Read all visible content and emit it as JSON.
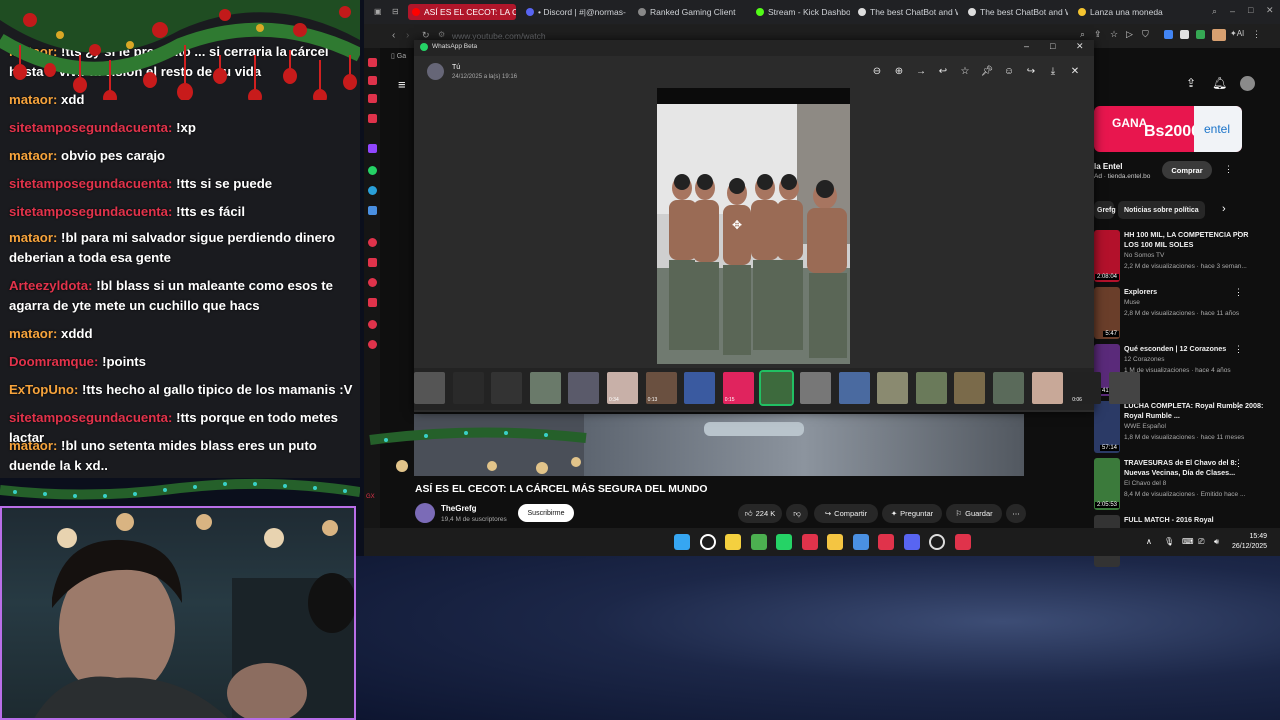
{
  "chat": {
    "messages": [
      {
        "user": "mataor:",
        "text": "!tts ¿y si le pregunto ... si cerraria la cárcel hasta o vivir la vision el resto de su vida",
        "color": "orange"
      },
      {
        "user": "mataor:",
        "text": "xdd",
        "color": "orange"
      },
      {
        "user": "sitetamposegundacuenta:",
        "text": "!xp",
        "color": "red"
      },
      {
        "user": "mataor:",
        "text": "obvio pes carajo",
        "color": "orange"
      },
      {
        "user": "sitetamposegundacuenta:",
        "text": "!tts si se puede",
        "color": "red"
      },
      {
        "user": "sitetamposegundacuenta:",
        "text": "!tts es fácil",
        "color": "red"
      },
      {
        "user": "mataor:",
        "text": "!bl para mi salvador sigue perdiendo dinero deberian a toda esa gente",
        "color": "orange"
      },
      {
        "user": "Arteezyldota:",
        "text": "!bl blass si un maleante como esos te agarra de yte mete un cuchillo que hacs",
        "color": "red"
      },
      {
        "user": "mataor:",
        "text": "xddd",
        "color": "orange"
      },
      {
        "user": "Doomramque:",
        "text": "!points",
        "color": "red"
      },
      {
        "user": "ExTopUno:",
        "text": "!tts hecho al gallo tipico de los mamanis :V",
        "color": "orange"
      },
      {
        "user": "sitetamposegundacuenta:",
        "text": "!tts porque en todo metes lactar",
        "color": "red"
      },
      {
        "user": "mataor:",
        "text": "!bl uno setenta mides blass eres un puto duende la k xd..",
        "color": "orange"
      }
    ]
  },
  "browser": {
    "tabs": [
      {
        "label": "ASÍ ES EL CECOT: LA CÁRCEL",
        "color": "#ff0000",
        "active": true
      },
      {
        "label": "• Discord | #|@normas-",
        "color": "#5865f2",
        "active": false
      },
      {
        "label": "Ranked Gaming Client",
        "color": "#888888",
        "active": false
      },
      {
        "label": "Stream - Kick Dashboard",
        "color": "#53fc18",
        "active": false
      },
      {
        "label": "The best ChatBot and W",
        "color": "#dddddd",
        "active": false
      },
      {
        "label": "The best ChatBot and W",
        "color": "#dddddd",
        "active": false
      },
      {
        "label": "Lanza una moneda",
        "color": "#f4c430",
        "active": false
      }
    ],
    "url": "www.youtube.com/watch",
    "bookmark_first": "Ga"
  },
  "whatsapp": {
    "window_title": "WhatsApp Beta",
    "sender": "Tú",
    "date": "24/12/2025 a la(s) 19:16",
    "toolbar_icons": [
      "zoom-out-icon",
      "zoom-in-icon",
      "forward-icon",
      "reply-icon",
      "star-icon",
      "pin-icon",
      "emoji-icon",
      "share-icon",
      "download-icon",
      "close-icon"
    ],
    "strip_durations": [
      "0:34",
      "0:13",
      "0:15",
      "0:06"
    ]
  },
  "youtube": {
    "ad": {
      "headline": "GANA",
      "amount": "Bs20000",
      "brand": "entel",
      "advertiser": "la Entel",
      "advertiser_domain": "tienda.entel.bo",
      "cta": "Comprar"
    },
    "chips": [
      "Grefg",
      "Noticias sobre política"
    ],
    "videos": [
      {
        "title": "HH 100 MIL, LA COMPETENCIA POR LOS 100 MIL SOLES",
        "channel": "No Somos TV",
        "meta": "2,2 M de visualizaciones · hace 3 seman...",
        "duration": "2:08:04",
        "color": "#b3112b"
      },
      {
        "title": "Explorers",
        "channel": "Muse",
        "meta": "2,8 M de visualizaciones · hace 11 años",
        "duration": "5:47",
        "color": "#6a3e2a"
      },
      {
        "title": "Qué esconden | 12 Corazones",
        "channel": "12 Corazones",
        "meta": "1 M de visualizaciones · hace 4 años",
        "duration": "41:52",
        "color": "#5a2a7a"
      },
      {
        "title": "LUCHA COMPLETA: Royal Rumble 2008: Royal Rumble ...",
        "channel": "WWE Español",
        "meta": "1,8 M de visualizaciones · hace 11 meses",
        "duration": "57:14",
        "color": "#2b3a66"
      },
      {
        "title": "TRAVESURAS de El Chavo del 8: Nuevas Vecinas, Día de Clases...",
        "channel": "El Chavo del 8",
        "meta": "8,4 M de visualizaciones · Emitido hace ...",
        "duration": "2:05:53",
        "color": "#3b7a3b"
      },
      {
        "title": "FULL MATCH - 2016 Royal",
        "channel": "",
        "meta": "",
        "duration": "",
        "color": "#333333"
      }
    ],
    "main": {
      "title": "ASÍ ES EL CECOT: LA CÁRCEL MÁS SEGURA DEL MUNDO",
      "channel": "TheGrefg",
      "subscribers": "19,4 M de suscriptores",
      "subscribe": "Suscribirme",
      "likes": "224 K",
      "share": "Compartir",
      "ask": "Preguntar",
      "save": "Guardar"
    }
  },
  "taskbar": {
    "time": "15:49",
    "date": "26/12/2025",
    "tray_lang": "∧"
  },
  "colors": {
    "chat_orange": "#f6a33c",
    "chat_red": "#e2334b",
    "cam_border": "#b96ee8",
    "yt_red": "#ff0000"
  }
}
